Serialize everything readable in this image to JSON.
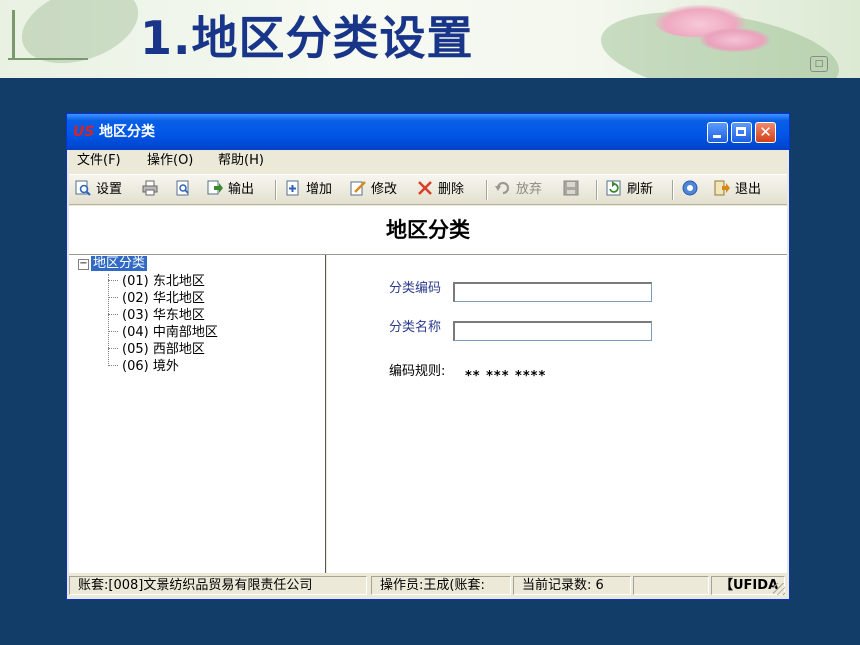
{
  "slide": {
    "title": "1.地区分类设置"
  },
  "window": {
    "title": "地区分类",
    "app_icon": "US"
  },
  "menu": {
    "items": [
      {
        "label": "文件(F)"
      },
      {
        "label": "操作(O)"
      },
      {
        "label": "帮助(H)"
      }
    ]
  },
  "toolbar": {
    "buttons": [
      {
        "label": "设置",
        "icon": "preview-icon",
        "enabled": true
      },
      {
        "label": "",
        "icon": "print-icon",
        "enabled": true
      },
      {
        "label": "",
        "icon": "print-preview-icon",
        "enabled": true
      },
      {
        "label": "输出",
        "icon": "export-icon",
        "enabled": true
      },
      {
        "label": "增加",
        "icon": "add-icon",
        "enabled": true
      },
      {
        "label": "修改",
        "icon": "edit-icon",
        "enabled": true
      },
      {
        "label": "删除",
        "icon": "delete-icon",
        "enabled": true
      },
      {
        "label": "放弃",
        "icon": "undo-icon",
        "enabled": false
      },
      {
        "label": "",
        "icon": "save-icon",
        "enabled": false
      },
      {
        "label": "刷新",
        "icon": "refresh-icon",
        "enabled": true
      },
      {
        "label": "",
        "icon": "help-icon",
        "enabled": true
      },
      {
        "label": "退出",
        "icon": "exit-icon",
        "enabled": true
      }
    ]
  },
  "form": {
    "title": "地区分类"
  },
  "tree": {
    "root": "地区分类",
    "items": [
      {
        "label": "(01) 东北地区"
      },
      {
        "label": "(02) 华北地区"
      },
      {
        "label": "(03) 华东地区"
      },
      {
        "label": "(04) 中南部地区"
      },
      {
        "label": "(05) 西部地区"
      },
      {
        "label": "(06) 境外"
      }
    ]
  },
  "detail": {
    "code_label": "分类编码",
    "code_value": "",
    "name_label": "分类名称",
    "name_value": "",
    "rule_label": "编码规则:",
    "rule_value": "** *** ****"
  },
  "status": {
    "account": "账套:[008]文景纺织品贸易有限责任公司",
    "operator": "操作员:王成(账套:",
    "record_count": "当前记录数: 6",
    "blank": "",
    "brand": "【UFIDA"
  },
  "colors": {
    "slide_background": "#113d68",
    "title_color": "#19358a",
    "titlebar_blue": "#0055e5",
    "selection": "#316ac5",
    "label_blue": "#2c3c8c"
  }
}
